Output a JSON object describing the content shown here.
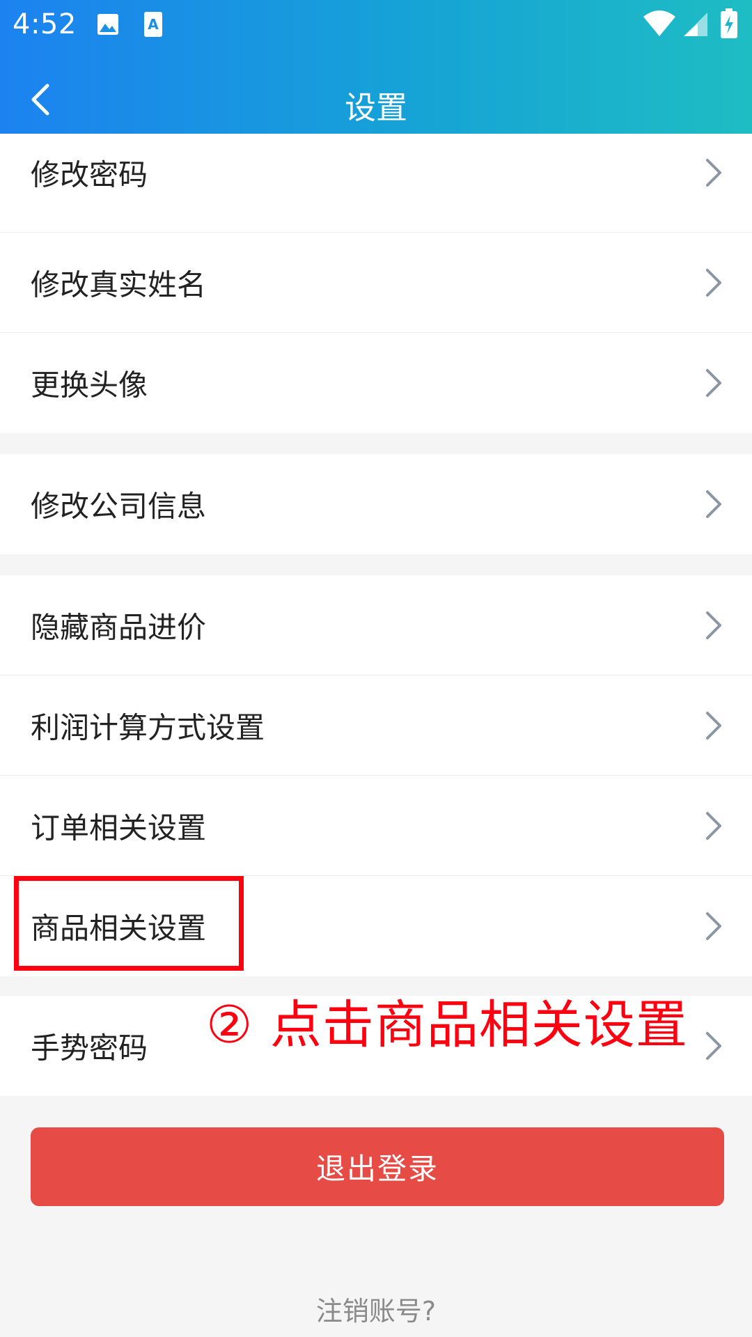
{
  "status_bar": {
    "time": "4:52",
    "icons": [
      "image-icon",
      "a-icon",
      "wifi-icon",
      "signal-icon",
      "battery-charging-icon"
    ]
  },
  "header": {
    "title": "设置",
    "back_icon": "back-arrow-icon"
  },
  "groups": [
    {
      "items": [
        {
          "label": "修改密码"
        },
        {
          "label": "修改真实姓名"
        },
        {
          "label": "更换头像"
        }
      ]
    },
    {
      "items": [
        {
          "label": "修改公司信息"
        }
      ]
    },
    {
      "items": [
        {
          "label": "隐藏商品进价"
        },
        {
          "label": "利润计算方式设置"
        },
        {
          "label": "订单相关设置"
        },
        {
          "label": "商品相关设置"
        }
      ]
    },
    {
      "items": [
        {
          "label": "手势密码"
        }
      ]
    }
  ],
  "annotation": {
    "text": "② 点击商品相关设置",
    "highlight_color": "#ff0010"
  },
  "logout_button": {
    "label": "退出登录",
    "color": "#e64c45"
  },
  "cancel_account_link": {
    "label": "注销账号?"
  },
  "colors": {
    "header_gradient": [
      "#1c82f0",
      "#16a3d6",
      "#1ebdc3"
    ],
    "background": "#f5f5f5"
  }
}
